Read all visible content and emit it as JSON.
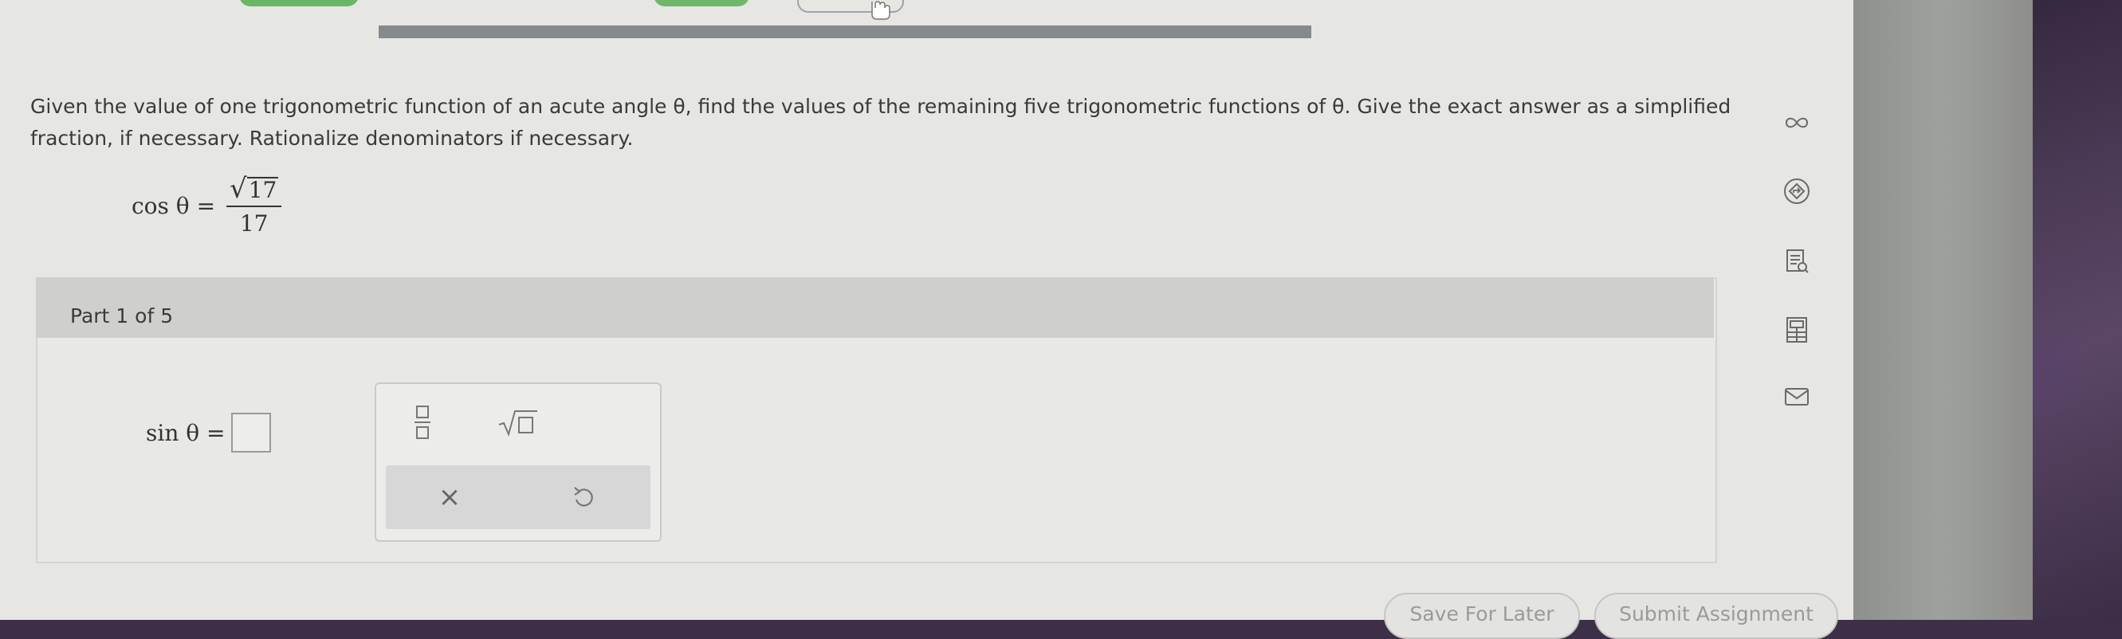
{
  "question": {
    "text": "Given the value of one trigonometric function of an acute angle θ, find the values of the remaining five trigonometric functions of θ. Give the exact answer as a simplified fraction, if necessary. Rationalize denominators if necessary.",
    "given_lhs": "cos θ =",
    "given_numerator": "17",
    "given_denominator": "17"
  },
  "part": {
    "label": "Part 1 of 5",
    "answer_lhs": "sin θ ="
  },
  "tools": {
    "fraction_icon": "fraction-icon",
    "sqrt_icon": "sqrt-icon",
    "clear_icon": "clear-icon",
    "undo_icon": "undo-icon",
    "clear_glyph": "×"
  },
  "side_icons": [
    "infinity-icon",
    "diamond-arrow-icon",
    "document-icon",
    "calculator-icon",
    "mail-icon"
  ],
  "bottom": {
    "save_label": "Save For Later",
    "submit_label": "Submit Assignment"
  },
  "colors": {
    "screen_bg": "#e6e6e3",
    "progress": "#86898d",
    "tab_green": "#6db86a"
  }
}
